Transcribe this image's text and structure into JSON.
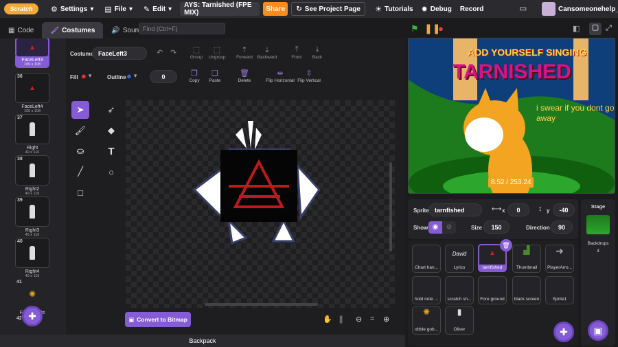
{
  "menu": {
    "logo": "Scratch",
    "settings": "Settings",
    "file": "File",
    "edit": "Edit",
    "project_title": "AYS: Tarnished (FPE MIX)",
    "share": "Share",
    "see_project": "See Project Page",
    "tutorials": "Tutorials",
    "debug": "Debug",
    "record": "Record",
    "username": "Cansomeonehelp_"
  },
  "tabs": {
    "code": "Code",
    "costumes": "Costumes",
    "sounds": "Sounds"
  },
  "find_placeholder": "Find (Ctrl+F)",
  "costumes": [
    {
      "num": "",
      "name": "FaceLeft3",
      "size": "109 x 108",
      "selected": true
    },
    {
      "num": "36",
      "name": "FaceLeft4",
      "size": "109 x 108"
    },
    {
      "num": "37",
      "name": "Right",
      "size": "49 x 116"
    },
    {
      "num": "38",
      "name": "Right2",
      "size": "49 x 116"
    },
    {
      "num": "39",
      "name": "Right3",
      "size": "49 x 116"
    },
    {
      "num": "40",
      "name": "Right4",
      "size": "49 x 116"
    },
    {
      "num": "41",
      "name": "FoundRight",
      "size": ""
    },
    {
      "num": "42",
      "name": "",
      "size": ""
    }
  ],
  "editor": {
    "costume_label": "Costume",
    "costume_name": "FaceLeft3",
    "fill_label": "Fill",
    "outline_label": "Outline",
    "outline_width": "0",
    "group": "Group",
    "ungroup": "Ungroup",
    "forward": "Forward",
    "backward": "Backward",
    "front": "Front",
    "back": "Back",
    "copy": "Copy",
    "paste": "Paste",
    "delete": "Delete",
    "flip_h": "Flip Horizontal",
    "flip_v": "Flip Vertical",
    "convert": "Convert to Bitmap"
  },
  "backpack": "Backpack",
  "stage": {
    "title_line1": "ADD YOURSELF SINGING",
    "title_line2": "TARNISHED",
    "lyric": "i swear if you dont go away",
    "timer": "8.52 / 253.24"
  },
  "sprite_info": {
    "sprite_label": "Sprite",
    "sprite_name": "tarnfished",
    "x_label": "x",
    "x": "0",
    "y_label": "y",
    "y": "-40",
    "show_label": "Show",
    "size_label": "Size",
    "size": "150",
    "direction_label": "Direction",
    "direction": "90"
  },
  "sprites": [
    {
      "name": "Chart han...",
      "thumb": ""
    },
    {
      "name": "Lyrics",
      "thumb": "David"
    },
    {
      "name": "tarnfished",
      "thumb": "",
      "selected": true
    },
    {
      "name": "Thumbnail",
      "thumb": ""
    },
    {
      "name": "PlayerArro...",
      "thumb": ""
    },
    {
      "name": "hold note ...",
      "thumb": ""
    },
    {
      "name": "scratch sh...",
      "thumb": ""
    },
    {
      "name": "Fore ground",
      "thumb": ""
    },
    {
      "name": "black screen",
      "thumb": ""
    },
    {
      "name": "Sprite1",
      "thumb": ""
    },
    {
      "name": "obble gob...",
      "thumb": ""
    },
    {
      "name": "Oliver",
      "thumb": ""
    }
  ],
  "stage_panel": {
    "label": "Stage",
    "backdrops_label": "Backdrops",
    "backdrops_count": "4"
  },
  "colors": {
    "accent": "#855cd6",
    "share": "#ff8c1a",
    "bg": "#1b1b1e"
  }
}
